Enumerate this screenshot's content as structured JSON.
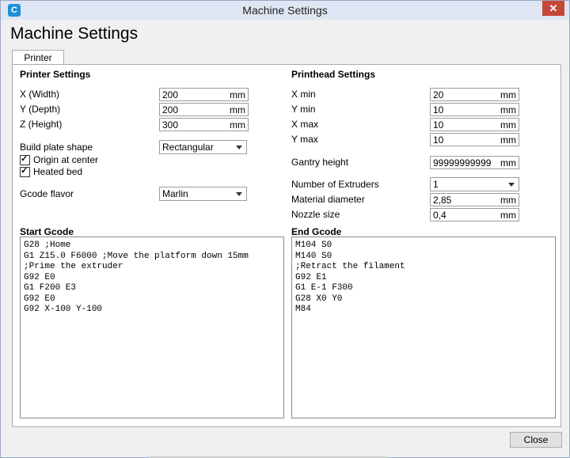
{
  "window": {
    "title": "Machine Settings",
    "app_icon": "C",
    "close_glyph": "✕"
  },
  "dialog": {
    "heading": "Machine Settings",
    "tabs": [
      {
        "label": "Printer"
      }
    ],
    "close_label": "Close"
  },
  "printer": {
    "section": "Printer Settings",
    "x_label": "X (Width)",
    "x_value": "200",
    "y_label": "Y (Depth)",
    "y_value": "200",
    "z_label": "Z (Height)",
    "z_value": "300",
    "unit": "mm",
    "plate_label": "Build plate shape",
    "plate_value": "Rectangular",
    "origin_label": "Origin at center",
    "heated_label": "Heated bed",
    "flavor_label": "Gcode flavor",
    "flavor_value": "Marlin"
  },
  "printhead": {
    "section": "Printhead Settings",
    "xmin_label": "X min",
    "xmin_value": "20",
    "ymin_label": "Y min",
    "ymin_value": "10",
    "xmax_label": "X max",
    "xmax_value": "10",
    "ymax_label": "Y max",
    "ymax_value": "10",
    "gantry_label": "Gantry height",
    "gantry_value": "99999999999",
    "extruders_label": "Number of Extruders",
    "extruders_value": "1",
    "material_label": "Material diameter",
    "material_value": "2,85",
    "nozzle_label": "Nozzle size",
    "nozzle_value": "0,4"
  },
  "start_gcode": {
    "label": "Start Gcode",
    "lines": [
      "G28 ;Home",
      "G1 Z15.0 F6000 ;Move the platform down 15mm",
      ";Prime the extruder",
      "G92 E0",
      "G1 F200 E3",
      "G92 E0",
      "G92 X-100 Y-100"
    ]
  },
  "end_gcode": {
    "label": "End Gcode",
    "lines": [
      "M104 S0",
      "M140 S0",
      ";Retract the filament",
      "G92 E1",
      "G1 E-1 F300",
      "G28 X0 Y0",
      "M84"
    ]
  },
  "colors": {
    "titlebar": "#dfe6f3",
    "close": "#c7463a",
    "app_icon": "#1e8fd6"
  }
}
